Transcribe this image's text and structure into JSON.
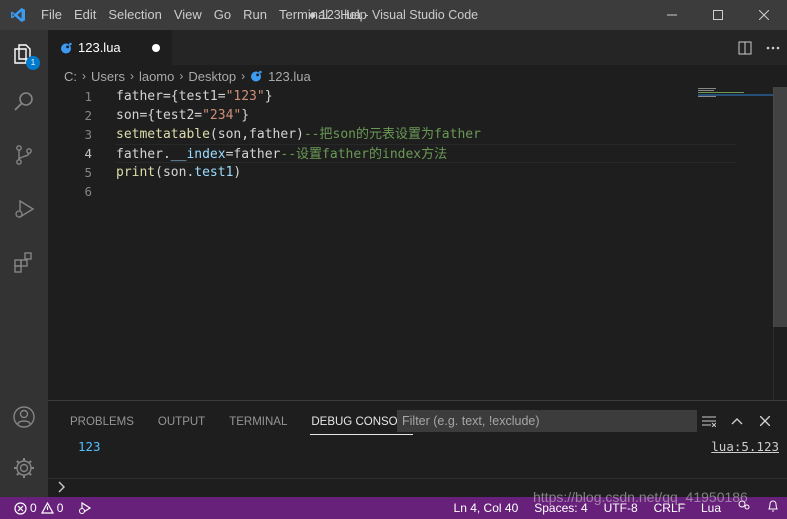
{
  "window": {
    "title": "● 123.lua - Visual Studio Code",
    "logo_icon": "vscode-logo-icon"
  },
  "menu": [
    "File",
    "Edit",
    "Selection",
    "View",
    "Go",
    "Run",
    "Terminal",
    "Help"
  ],
  "activitybar": {
    "items": [
      "files-icon",
      "search-icon",
      "source-control-icon",
      "run-debug-icon",
      "extensions-icon"
    ],
    "explorer_badge": "1",
    "bottom": [
      "account-icon",
      "settings-gear-icon"
    ]
  },
  "tabs": [
    {
      "label": "123.lua",
      "modified": true
    }
  ],
  "breadcrumb": [
    "C:",
    "Users",
    "laomo",
    "Desktop",
    "123.lua"
  ],
  "editor": {
    "line_numbers": [
      "1",
      "2",
      "3",
      "4",
      "5",
      "6"
    ],
    "active_line": 4,
    "lines": [
      [
        {
          "t": "father={test1=",
          "c": "plain"
        },
        {
          "t": "\"123\"",
          "c": "str"
        },
        {
          "t": "}",
          "c": "plain"
        }
      ],
      [
        {
          "t": "son={test2=",
          "c": "plain"
        },
        {
          "t": "\"234\"",
          "c": "str"
        },
        {
          "t": "}",
          "c": "plain"
        }
      ],
      [
        {
          "t": "setmetatable",
          "c": "kw"
        },
        {
          "t": "(son,father)",
          "c": "plain"
        },
        {
          "t": "--把son的元表设置为father",
          "c": "cm"
        }
      ],
      [
        {
          "t": "father.",
          "c": "plain"
        },
        {
          "t": "__index",
          "c": "var"
        },
        {
          "t": "=father",
          "c": "plain"
        },
        {
          "t": "--设置father的index方法",
          "c": "cm"
        }
      ],
      [
        {
          "t": "print",
          "c": "kw"
        },
        {
          "t": "(son.",
          "c": "plain"
        },
        {
          "t": "test1",
          "c": "var"
        },
        {
          "t": ")",
          "c": "plain"
        }
      ],
      []
    ]
  },
  "panel": {
    "tabs": [
      "PROBLEMS",
      "OUTPUT",
      "TERMINAL",
      "DEBUG CONSOLE"
    ],
    "active_tab": "DEBUG CONSOLE",
    "filter_placeholder": "Filter (e.g. text, !exclude)",
    "output_value": "123",
    "output_source": "lua:5.123",
    "prompt": ">"
  },
  "statusbar": {
    "errors": "0",
    "warnings": "0",
    "position": "Ln 4, Col 40",
    "spaces": "Spaces: 4",
    "encoding": "UTF-8",
    "eol": "CRLF",
    "language": "Lua",
    "color": "#68217a"
  },
  "watermark": "https://blog.csdn.net/qq_41950186"
}
